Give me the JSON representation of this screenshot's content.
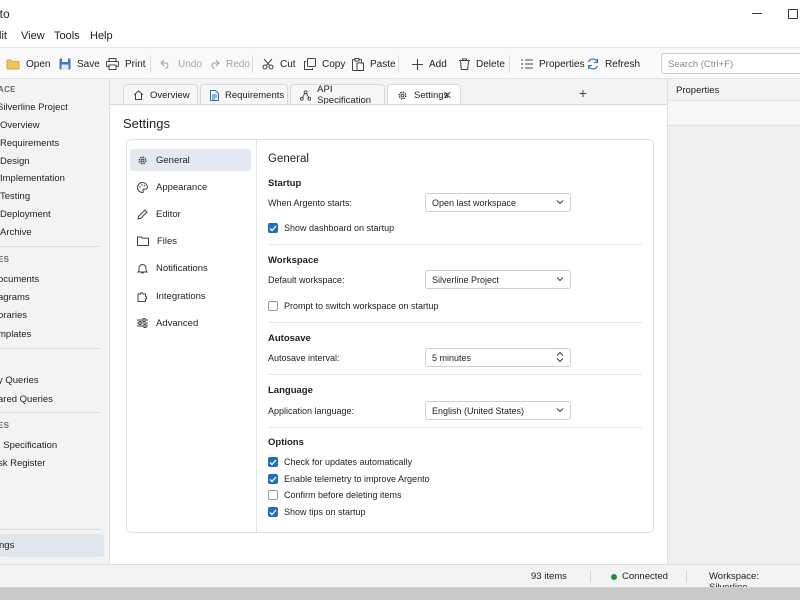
{
  "window": {
    "title": "nto"
  },
  "menu": [
    "lit",
    "View",
    "Tools",
    "Help"
  ],
  "toolbar": {
    "open": "Open",
    "save": "Save",
    "print": "Print",
    "undo": "Undo",
    "redo": "Redo",
    "cut": "Cut",
    "copy": "Copy",
    "paste": "Paste",
    "add": "Add",
    "delete": "Delete",
    "properties": "Properties",
    "refresh": "Refresh"
  },
  "search": {
    "placeholder": "Search (Ctrl+F)"
  },
  "sidebar": {
    "workspace_heading": "ACE",
    "project": "Silverline Project",
    "project_items": [
      "Overview",
      "Requirements",
      "Design",
      "Implementation",
      "Testing",
      "Deployment",
      "Archive"
    ],
    "items_heading": "ES",
    "items": [
      "ocuments",
      "agrams",
      "oraries",
      "mplates"
    ],
    "queries": [
      "y Queries",
      "ared Queries"
    ],
    "recent_heading": "ES",
    "recent": [
      "I Specification",
      "sk Register"
    ],
    "settings": "ngs"
  },
  "tabs": [
    "Overview",
    "Requirements",
    "API Specification",
    "Settings"
  ],
  "page": {
    "title": "Settings"
  },
  "settings_nav": [
    "General",
    "Appearance",
    "Editor",
    "Files",
    "Notifications",
    "Integrations",
    "Advanced"
  ],
  "general": {
    "title": "General",
    "startup": {
      "heading": "Startup",
      "when_label": "When Argento starts:",
      "when_value": "Open last workspace",
      "show_dashboard": "Show dashboard on startup",
      "show_dashboard_checked": true
    },
    "workspace": {
      "heading": "Workspace",
      "default_label": "Default workspace:",
      "default_value": "Silverline Project",
      "prompt_switch": "Prompt to switch workspace on startup",
      "prompt_switch_checked": false
    },
    "autosave": {
      "heading": "Autosave",
      "interval_label": "Autosave interval:",
      "interval_value": "5 minutes"
    },
    "language": {
      "heading": "Language",
      "app_label": "Application language:",
      "app_value": "English (United States)"
    },
    "options": {
      "heading": "Options",
      "items": [
        {
          "label": "Check for updates automatically",
          "checked": true
        },
        {
          "label": "Enable telemetry to improve Argento",
          "checked": true
        },
        {
          "label": "Confirm before deleting items",
          "checked": false
        },
        {
          "label": "Show tips on startup",
          "checked": true
        }
      ]
    }
  },
  "properties_panel": {
    "title": "Properties"
  },
  "status": {
    "items": "93 items",
    "connection": "Connected",
    "workspace": "Workspace: Silverline"
  },
  "colors": {
    "accent": "#1f6fbf",
    "connected": "#1a8f3c",
    "selected_bg": "#e3e9f0"
  }
}
